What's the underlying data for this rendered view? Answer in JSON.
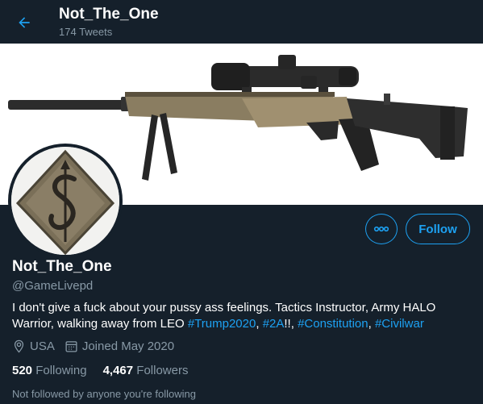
{
  "header": {
    "name": "Not_The_One",
    "tweet_count": "174 Tweets"
  },
  "profile": {
    "display_name": "Not_The_One",
    "handle": "@GameLivepd",
    "bio_text": "I don't give a fuck about your pussy ass feelings. Tactics Instructor, Army HALO Warrior, walking away from LEO ",
    "bio_tags": [
      "#Trump2020",
      "#2A",
      "#Constitution",
      "#Civilwar"
    ],
    "bio_sep_1": ", ",
    "bio_sep_2": "!!, ",
    "bio_sep_3": ", ",
    "location": "USA",
    "joined": "Joined May 2020",
    "following_count": "520",
    "following_label": "Following",
    "followers_count": "4,467",
    "followers_label": "Followers",
    "followed_note": "Not followed by anyone you're following"
  },
  "actions": {
    "follow_label": "Follow"
  },
  "icons": {
    "back": "arrow-left-icon",
    "more": "more-horizontal-icon",
    "location": "location-pin-icon",
    "calendar": "calendar-icon"
  },
  "colors": {
    "background": "#15202b",
    "accent": "#1da1f2",
    "secondary_text": "#8899a6"
  }
}
